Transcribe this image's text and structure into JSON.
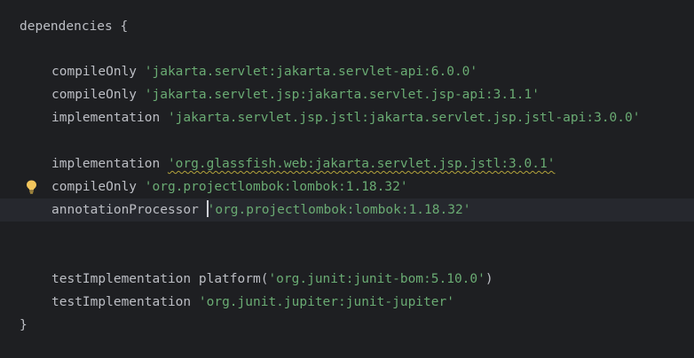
{
  "code": {
    "line_open": {
      "keyword": "dependencies",
      "brace": " {"
    },
    "line_compile_servlet": {
      "method": "compileOnly ",
      "arg": "'jakarta.servlet:jakarta.servlet-api:6.0.0'"
    },
    "line_compile_jsp": {
      "method": "compileOnly ",
      "arg": "'jakarta.servlet.jsp:jakarta.servlet.jsp-api:3.1.1'"
    },
    "line_impl_jstl_api": {
      "method": "implementation ",
      "arg": "'jakarta.servlet.jsp.jstl:jakarta.servlet.jsp.jstl-api:3.0.0'"
    },
    "line_impl_glassfish": {
      "method": "implementation ",
      "arg": "'org.glassfish.web:jakarta.servlet.jsp.jstl:3.0.1'"
    },
    "line_compile_lombok": {
      "method": "compileOnly ",
      "arg": "'org.projectlombok:lombok:1.18.32'"
    },
    "line_annotation_lombok": {
      "method": "annotationProcessor ",
      "arg": "'org.projectlombok:lombok:1.18.32'"
    },
    "line_test_platform": {
      "method": "testImplementation platform(",
      "arg": "'org.junit:junit-bom:5.10.0'",
      "close": ")"
    },
    "line_test_jupiter": {
      "method": "testImplementation ",
      "arg": "'org.junit.jupiter:junit-jupiter'"
    },
    "line_close": {
      "brace": "}"
    }
  },
  "colors": {
    "background": "#1e1f22",
    "current_line": "#26282e",
    "plain_text": "#bcbec4",
    "string": "#6aab73",
    "warning_underline": "#b3a33b",
    "bulb": "#f2c55c"
  },
  "icons": {
    "intention": "lightbulb-icon"
  }
}
